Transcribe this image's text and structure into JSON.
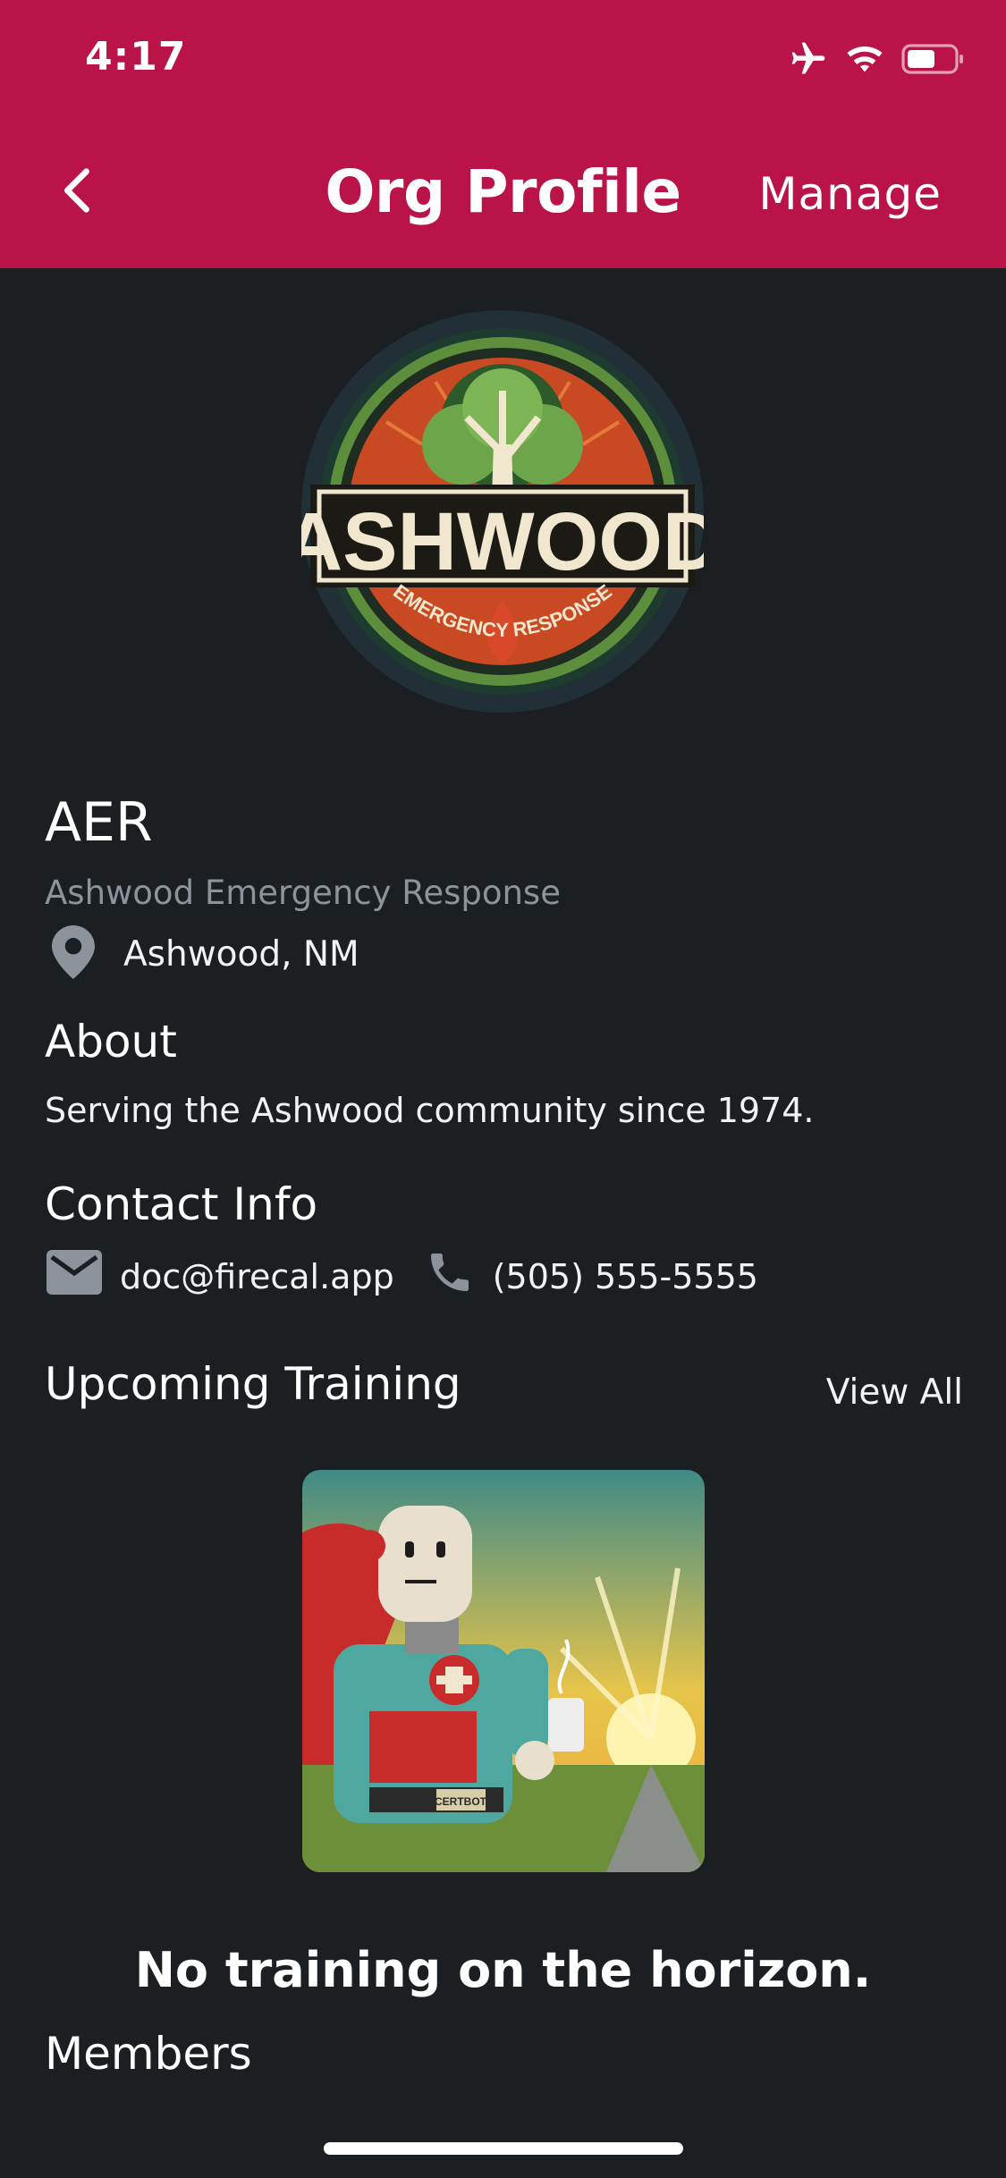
{
  "status_bar": {
    "time": "4:17"
  },
  "nav": {
    "title": "Org Profile",
    "manage_label": "Manage"
  },
  "org": {
    "short_name": "AER",
    "full_name": "Ashwood Emergency Response",
    "location": "Ashwood, NM",
    "logo_text": "ASHWOOD",
    "logo_subtext": "EMERGENCY RESPONSE"
  },
  "about": {
    "title": "About",
    "text": "Serving the Ashwood community since 1974."
  },
  "contact": {
    "title": "Contact Info",
    "email": "doc@firecal.app",
    "phone": "(505) 555-5555"
  },
  "training": {
    "title": "Upcoming Training",
    "view_all_label": "View All",
    "empty_text": "No training on the horizon.",
    "image_badge": "CERTBOT"
  },
  "members": {
    "title": "Members"
  },
  "colors": {
    "header": "#b91347",
    "background": "#1c1f22",
    "muted_text": "#8d939b"
  },
  "icons": [
    "airplane-icon",
    "wifi-icon",
    "battery-icon",
    "back-chevron-icon",
    "location-pin-icon",
    "email-icon",
    "phone-icon"
  ]
}
